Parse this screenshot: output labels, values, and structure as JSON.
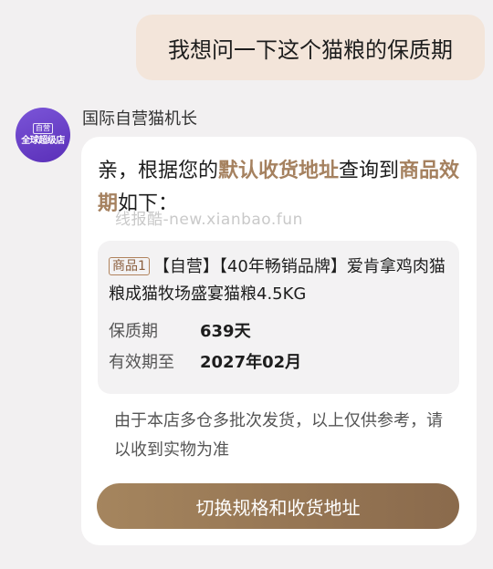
{
  "user_message": "我想问一下这个猫粮的保质期",
  "shop": {
    "name": "国际自营猫机长",
    "avatar_tag": "自营",
    "avatar_text": "全球超级店"
  },
  "reply": {
    "p1": "亲，根据您的",
    "hl1": "默认收货地址",
    "p2": "查询到",
    "hl2": "商品效期",
    "p3": "如下："
  },
  "watermark": "线报酷-new.xianbao.fun",
  "product": {
    "badge": "商品1",
    "title": "【自营】【40年畅销品牌】爱肯拿鸡肉猫粮成猫牧场盛宴猫粮4.5KG",
    "shelf_life_label": "保质期",
    "shelf_life_value": "639天",
    "expiry_label": "有效期至",
    "expiry_value": "2027年02月"
  },
  "note": "由于本店多仓多批次发货，以上仅供参考，请以收到实物为准",
  "action_button": "切换规格和收货地址",
  "colors": {
    "accent": "#a5815f",
    "user_bubble": "#f3e5da",
    "avatar": "#6a3fc8"
  }
}
